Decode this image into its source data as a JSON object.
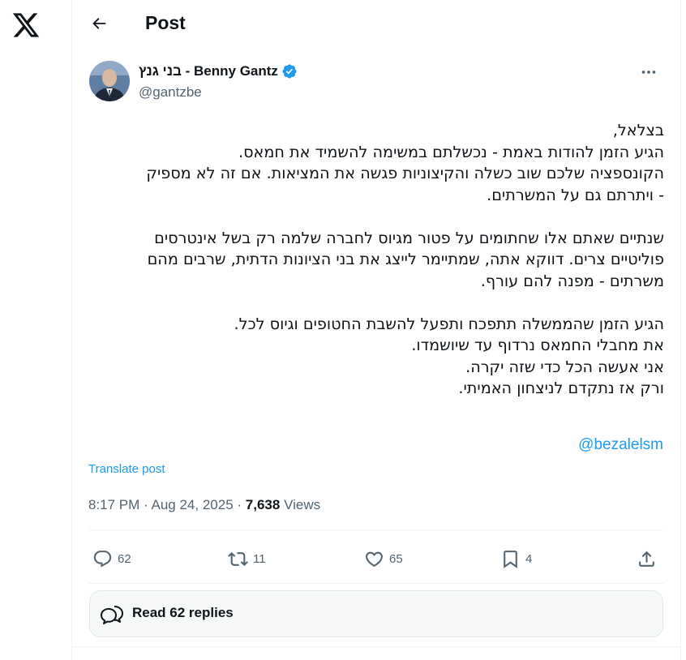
{
  "nav": {
    "logo_icon": "x-logo-icon"
  },
  "header": {
    "title": "Post",
    "back_icon": "arrow-left-icon"
  },
  "author": {
    "name": "בני גנץ - Benny Gantz",
    "handle": "@gantzbe",
    "verified_color": "#1d9bf0"
  },
  "post": {
    "lines": [
      "בצלאל,",
      "הגיע הזמן להודות באמת - נכשלתם במשימה להשמיד את חמאס.",
      "הקונספציה שלכם שוב כשלה והקיצוניות פגשה את המציאות. אם זה לא מספיק",
      "- ויתרתם גם על המשרתים.",
      "",
      "שנתיים שאתם אלו שחתומים על פטור מגיוס לחברה שלמה רק בשל אינטרסים",
      "פוליטיים צרים. דווקא אתה, שמתיימר לייצג את בני הציונות הדתית, שרבים מהם",
      "משרתים - מפנה להם עורף.",
      "",
      "הגיע הזמן שהממשלה תתפכח ותפעל להשבת החטופים וגיוס לכל.",
      "את מחבלי החמאס נרדוף עד שיושמדו.",
      "אני אעשה הכל כדי שזה יקרה.",
      "ורק אז נתקדם לניצחון האמיתי."
    ],
    "mention": "@bezalelsm",
    "translate_label": "Translate post",
    "time": "8:17 PM",
    "date": "Aug 24, 2025",
    "views_count": "7,638",
    "views_label": "Views"
  },
  "actions": {
    "replies": "62",
    "reposts": "11",
    "likes": "65",
    "bookmarks": "4"
  },
  "replies_button": {
    "label": "Read 62 replies"
  },
  "colors": {
    "accent": "#1d9bf0",
    "muted": "#536471",
    "text": "#0f1419"
  }
}
